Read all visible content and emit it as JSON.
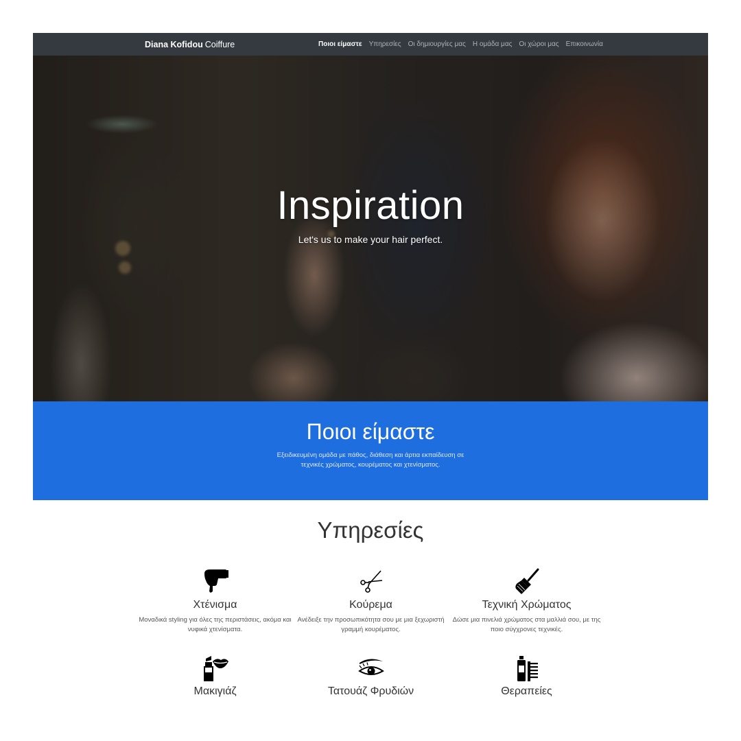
{
  "navbar": {
    "brand_strong": "Diana Kofidou",
    "brand_light": "Coiffure",
    "links": [
      {
        "label": "Ποιοι είμαστε",
        "active": true
      },
      {
        "label": "Υπηρεσίες",
        "active": false
      },
      {
        "label": "Οι δημιουργίες μας",
        "active": false
      },
      {
        "label": "Η ομάδα μας",
        "active": false
      },
      {
        "label": "Οι χώροι μας",
        "active": false
      },
      {
        "label": "Επικοινωνία",
        "active": false
      }
    ]
  },
  "hero": {
    "title": "Inspiration",
    "subtitle": "Let's us to make your hair perfect."
  },
  "about": {
    "title": "Ποιοι είμαστε",
    "text": "Εξειδικευμένη ομάδα με πάθος, διάθεση και άρτια εκπαίδευση σε τεχνικές χρώματος, κουρέματος και χτενίσματος."
  },
  "services": {
    "title": "Υπηρεσίες",
    "items": [
      {
        "icon": "hair-dryer-icon",
        "name": "Χτένισμα",
        "desc": "Μοναδικά styling για όλες της περιστάσεις, ακόμα και νυφικά χτενίσματα."
      },
      {
        "icon": "scissors-icon",
        "name": "Κούρεμα",
        "desc": "Ανέδειξε την προσωπικότητα σου με μια ξεχωριστή γραμμή κουρέματος."
      },
      {
        "icon": "dye-brush-icon",
        "name": "Τεχνική Χρώματος",
        "desc": "Δώσε μια πινελιά χρώματος στα μαλλιά σου, με της ποιο σύγχρονες τεχνικές."
      },
      {
        "icon": "lipstick-icon",
        "name": "Μακιγιάζ",
        "desc": ""
      },
      {
        "icon": "eyebrow-icon",
        "name": "Τατουάζ Φρυδιών",
        "desc": ""
      },
      {
        "icon": "hair-products-icon",
        "name": "Θεραπείες",
        "desc": ""
      }
    ]
  }
}
